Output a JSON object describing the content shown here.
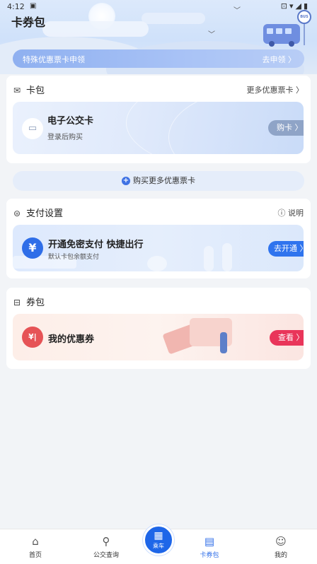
{
  "status_bar": {
    "time": "4:12"
  },
  "header": {
    "title": "卡券包"
  },
  "promo": {
    "text": "特殊优惠票卡申领",
    "link": "去申领 〉"
  },
  "card_section": {
    "title": "卡包",
    "more_link": "更多优惠票卡 〉",
    "bus_card": {
      "title": "电子公交卡",
      "subtitle": "登录后购买",
      "button": "购卡 〉"
    }
  },
  "buy_more": {
    "label": "购买更多优惠票卡"
  },
  "payment_section": {
    "title": "支付设置",
    "help_link": "说明",
    "promo_title": "开通免密支付  快捷出行",
    "promo_sub": "默认卡包余额支付",
    "button": "去开通 〉"
  },
  "coupon_section": {
    "title": "券包",
    "my_coupons": "我的优惠券",
    "button": "查看 〉"
  },
  "tabs": [
    {
      "label": "首页",
      "icon": "home-icon"
    },
    {
      "label": "公交查询",
      "icon": "route-icon"
    },
    {
      "label": "乘车",
      "icon": "qr-code-icon"
    },
    {
      "label": "卡券包",
      "icon": "wallet-icon"
    },
    {
      "label": "我的",
      "icon": "profile-icon"
    }
  ],
  "colors": {
    "accent": "#2f6ee8",
    "coupon_red": "#e9355a",
    "page_bg": "#f2f4f7"
  }
}
